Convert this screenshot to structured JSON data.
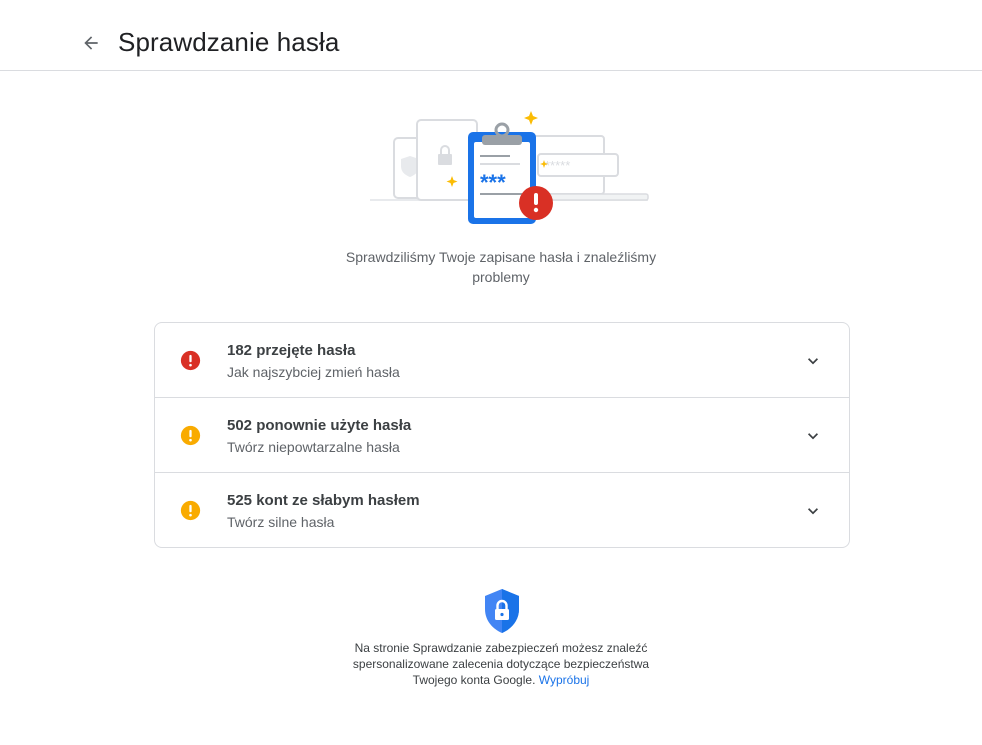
{
  "header": {
    "title": "Sprawdzanie hasła",
    "back_icon": "arrow-back-icon"
  },
  "hero": {
    "icon": "clipboard-password-illustration",
    "password_mask": "***",
    "field_mask": "*****"
  },
  "summary": "Sprawdziliśmy Twoje zapisane hasła i znaleźliśmy problemy",
  "issues": [
    {
      "title": "182 przejęte hasła",
      "subtitle": "Jak najszybciej zmień hasła",
      "severity": "error",
      "color": "#d93025",
      "icon": "error-icon"
    },
    {
      "title": "502 ponownie użyte hasła",
      "subtitle": "Twórz niepowtarzalne hasła",
      "severity": "warning",
      "color": "#f9ab00",
      "icon": "warning-icon"
    },
    {
      "title": "525 kont ze słabym hasłem",
      "subtitle": "Twórz silne hasła",
      "severity": "warning",
      "color": "#f9ab00",
      "icon": "warning-icon"
    }
  ],
  "footer": {
    "icon": "shield-lock-icon",
    "text": "Na stronie Sprawdzanie zabezpieczeń możesz znaleźć spersonalizowane zalecenia dotyczące bezpieczeństwa Twojego konta Google.",
    "link": "Wypróbuj"
  },
  "colors": {
    "accent": "#1a73e8",
    "error": "#d93025",
    "warning": "#f9ab00",
    "border": "#dadce0"
  }
}
